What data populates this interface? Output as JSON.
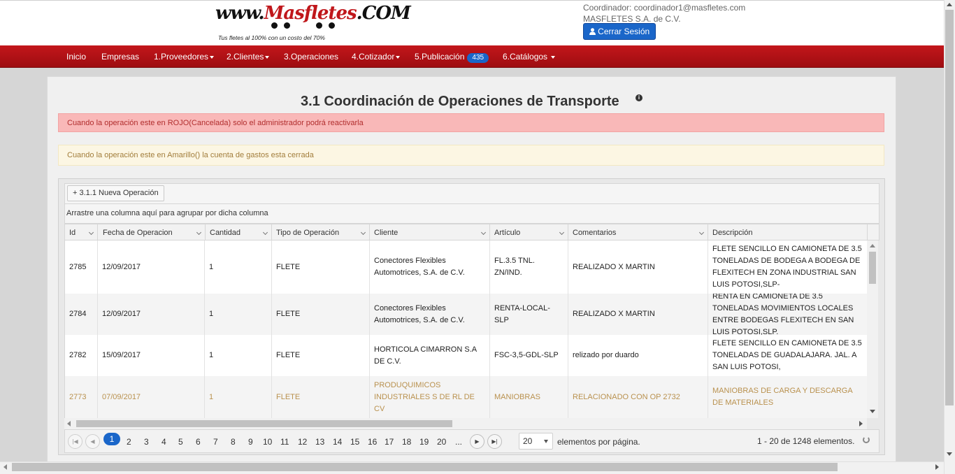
{
  "header": {
    "logo_text_a": "www.",
    "logo_text_b": "Masfletes",
    "logo_text_c": ".COM",
    "logo_tagline": "Tus fletes al 100% con un costo del 70%",
    "user_line": "Coordinador: coordinador1@masfletes.com",
    "company": "MASFLETES S.A. de C.V.",
    "logout_label": "Cerrar Sesión",
    "logout_icon": "user-icon"
  },
  "nav": [
    {
      "label": "Inicio",
      "dropdown": false
    },
    {
      "label": "Empresas",
      "dropdown": false
    },
    {
      "label": "1.Proveedores",
      "dropdown": true
    },
    {
      "label": "2.Clientes",
      "dropdown": true
    },
    {
      "label": "3.Operaciones",
      "dropdown": false
    },
    {
      "label": "4.Cotizador",
      "dropdown": true
    },
    {
      "label": "5.Publicación",
      "dropdown": false,
      "badge": "435"
    },
    {
      "label": "6.Catálogos",
      "dropdown": true
    }
  ],
  "page": {
    "title": "3.1 Coordinación de Operaciones de Transporte",
    "alert_danger": "Cuando la operación este en ROJO(Cancelada) solo el administrador podrá reactivarla",
    "alert_warning": "Cuando la operación este en Amarillo() la cuenta de gastos esta cerrada"
  },
  "grid": {
    "new_button": "+ 3.1.1 Nueva Operación",
    "group_hint": "Arrastre una columna aquí para agrupar por dicha columna",
    "columns": [
      "Id",
      "Fecha de Operacion",
      "Cantidad",
      "Tipo de Operación",
      "Cliente",
      "Artículo",
      "Comentarios",
      "Descripción"
    ],
    "rows": [
      {
        "id": "2785",
        "fecha": "12/09/2017",
        "cantidad": "1",
        "tipo": "FLETE",
        "cliente": "Conectores Flexibles Automotrices, S.A. de C.V.",
        "articulo": "FL.3.5 TNL. ZN/IND.",
        "comentarios": "REALIZADO X MARTIN",
        "descripcion": "FLETE SENCILLO EN CAMIONETA DE 3.5 TONELADAS DE BODEGA A BODEGA DE FLEXITECH EN ZONA INDUSTRIAL SAN LUIS POTOSI,SLP-",
        "status": "normal"
      },
      {
        "id": "2784",
        "fecha": "12/09/2017",
        "cantidad": "1",
        "tipo": "FLETE",
        "cliente": "Conectores Flexibles Automotrices, S.A. de C.V.",
        "articulo": "RENTA-LOCAL-SLP",
        "comentarios": "REALIZADO X MARTIN",
        "descripcion": "RENTA EN CAMIONETA DE 3.5 TONELADAS MOVIMIENTOS LOCALES ENTRE BODEGAS FLEXITECH EN SAN LUIS POTOSI,SLP.",
        "status": "normal"
      },
      {
        "id": "2782",
        "fecha": "15/09/2017",
        "cantidad": "1",
        "tipo": "FLETE",
        "cliente": "HORTICOLA CIMARRON S.A DE C.V.",
        "articulo": "FSC-3,5-GDL-SLP",
        "comentarios": "relizado por duardo",
        "descripcion": "FLETE SENCILLO EN CAMIONETA DE 3.5 TONELADAS DE GUADALAJARA. JAL. A SAN LUIS POTOSI,",
        "status": "normal"
      },
      {
        "id": "2773",
        "fecha": "07/09/2017",
        "cantidad": "1",
        "tipo": "FLETE",
        "cliente": "PRODUQUIMICOS INDUSTRIALES S DE RL DE CV",
        "articulo": "MANIOBRAS",
        "comentarios": "RELACIONADO CON OP 2732",
        "descripcion": "MANIOBRAS DE CARGA Y DESCARGA DE MATERIALES",
        "status": "closed"
      }
    ]
  },
  "pager": {
    "current": "1",
    "pages": [
      "2",
      "3",
      "4",
      "5",
      "6",
      "7",
      "8",
      "9",
      "10",
      "11",
      "12",
      "13",
      "14",
      "15",
      "16",
      "17",
      "18",
      "19",
      "20",
      "..."
    ],
    "page_size": "20",
    "page_size_label": "elementos por página.",
    "info": "1 - 20 de 1248 elementos."
  }
}
